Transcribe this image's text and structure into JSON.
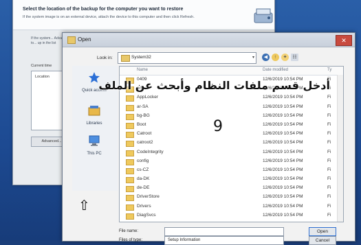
{
  "wizard": {
    "heading": "Select the location of the backup for the computer you want to restore",
    "subheading": "If the system image is on an external device, attach the device to this computer and then click Refresh.",
    "note": "If the system... Advanced to... up in the list",
    "current_label": "Current time",
    "location_header": "Location",
    "advanced_button": "Advanced..."
  },
  "dialog": {
    "title": "Open",
    "close_label": "✕",
    "look_in_label": "Look in:",
    "look_in_value": "System32",
    "columns": {
      "name": "Name",
      "date": "Date modified",
      "type": "Ty"
    },
    "places": [
      {
        "label": "Quick access",
        "icon": "star-icon"
      },
      {
        "label": "Libraries",
        "icon": "libraries-icon"
      },
      {
        "label": "This PC",
        "icon": "computer-icon"
      }
    ],
    "files": [
      {
        "name": "0409",
        "date": "12/6/2019 10:54 PM",
        "type": "Fi"
      },
      {
        "name": "am-et",
        "date": "12/6/2019 10:54 PM",
        "type": "Fi"
      },
      {
        "name": "AppLocker",
        "date": "12/6/2019 10:54 PM",
        "type": "Fi"
      },
      {
        "name": "ar-SA",
        "date": "12/6/2019 10:54 PM",
        "type": "Fi"
      },
      {
        "name": "bg-BG",
        "date": "12/6/2019 10:54 PM",
        "type": "Fi"
      },
      {
        "name": "Boot",
        "date": "12/6/2019 10:54 PM",
        "type": "Fi"
      },
      {
        "name": "Catroot",
        "date": "12/6/2019 10:54 PM",
        "type": "Fi"
      },
      {
        "name": "catroot2",
        "date": "12/6/2019 10:54 PM",
        "type": "Fi"
      },
      {
        "name": "CodeIntegrity",
        "date": "12/6/2019 10:54 PM",
        "type": "Fi"
      },
      {
        "name": "config",
        "date": "12/6/2019 10:54 PM",
        "type": "Fi"
      },
      {
        "name": "cs-CZ",
        "date": "12/6/2019 10:54 PM",
        "type": "Fi"
      },
      {
        "name": "da-DK",
        "date": "12/6/2019 10:54 PM",
        "type": "Fi"
      },
      {
        "name": "de-DE",
        "date": "12/6/2019 10:54 PM",
        "type": "Fi"
      },
      {
        "name": "DriverStore",
        "date": "12/6/2019 10:54 PM",
        "type": "Fi"
      },
      {
        "name": "Drivers",
        "date": "12/6/2019 10:54 PM",
        "type": "Fi"
      },
      {
        "name": "DiagSvcs",
        "date": "12/6/2019 10:54 PM",
        "type": "Fi"
      }
    ],
    "file_name_label": "File name:",
    "file_type_label": "Files of type:",
    "file_type_value": "Setup Information",
    "open_button": "Open",
    "cancel_button": "Cancel"
  },
  "overlay": {
    "instruction": "أدخل قسم ملفات النظام وأبحث عن الملف",
    "step_number": "9"
  },
  "colors": {
    "desktop": "#1d4a92",
    "folder": "#efc95d",
    "accent": "#2f6fd0"
  }
}
